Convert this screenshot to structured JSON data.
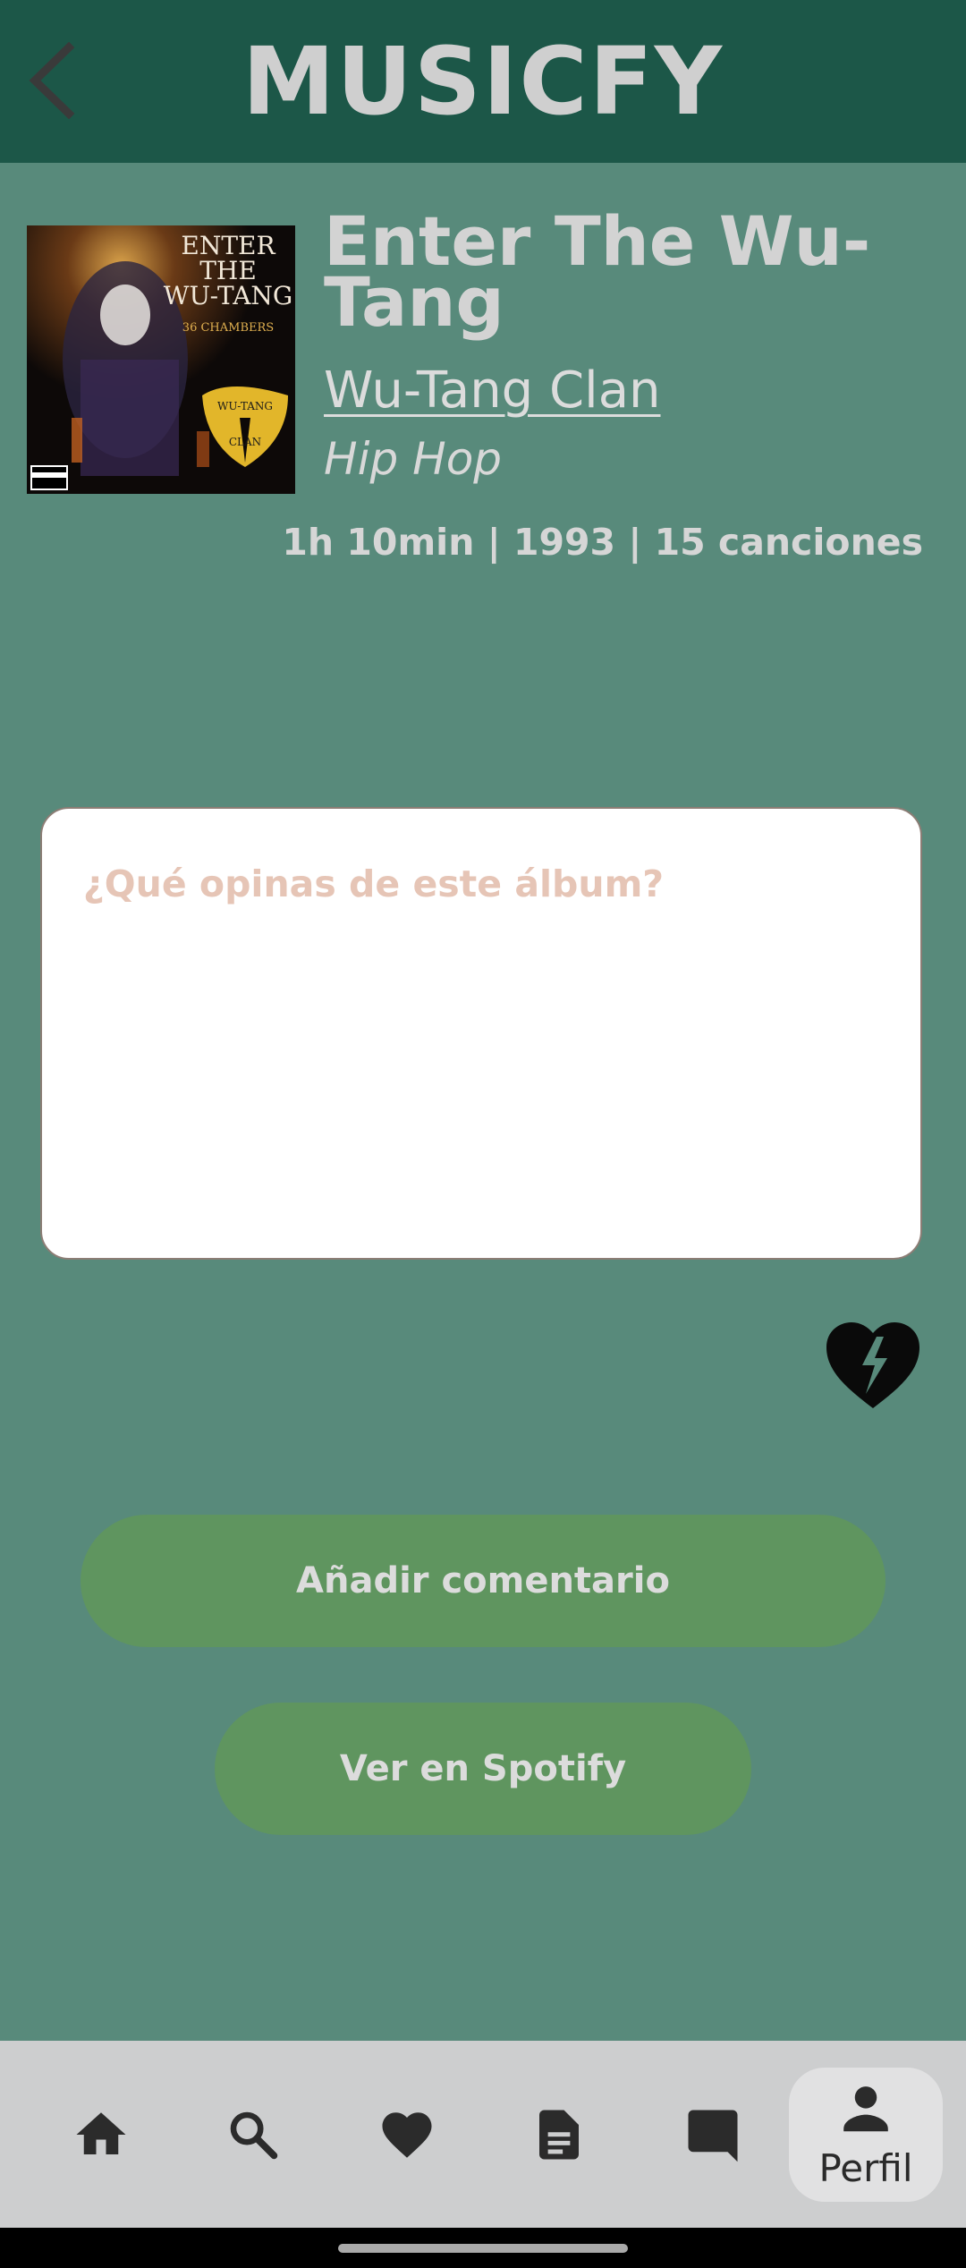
{
  "header": {
    "title": "MUSICFY",
    "back_icon": "chevron-left-icon"
  },
  "album": {
    "title": "Enter The Wu-Tang",
    "artist": "Wu-Tang Clan",
    "genre": "Hip Hop",
    "meta": "1h 10min | 1993 | 15 canciones"
  },
  "comment": {
    "placeholder": "¿Qué opinas de este álbum?",
    "value": ""
  },
  "actions": {
    "dislike_icon": "broken-heart-icon",
    "add_comment_label": "Añadir comentario",
    "spotify_label": "Ver en Spotify"
  },
  "bottom_nav": {
    "items": [
      {
        "icon": "home-icon"
      },
      {
        "icon": "search-icon"
      },
      {
        "icon": "heart-icon"
      },
      {
        "icon": "document-icon"
      },
      {
        "icon": "chat-icon"
      },
      {
        "icon": "person-icon",
        "label": "Perfil",
        "active": true
      }
    ]
  },
  "colors": {
    "header_bg": "#1c5748",
    "page_bg": "#588a7b",
    "button_bg": "#5f955f",
    "nav_bg": "#cdcecf",
    "placeholder": "#e6c5b6"
  }
}
